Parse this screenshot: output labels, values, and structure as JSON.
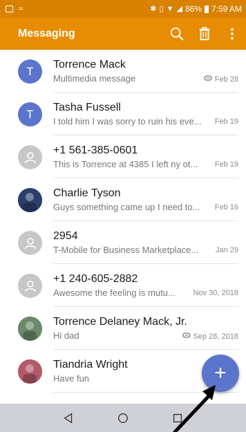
{
  "status_bar": {
    "battery": "86%",
    "time": "7:59 AM"
  },
  "app_bar": {
    "title": "Messaging",
    "actions": [
      "search-icon",
      "delete-icon",
      "more-vert-icon"
    ]
  },
  "conversations": [
    {
      "name": "Torrence Mack",
      "preview": "Multimedia message",
      "date": "Feb 28",
      "avatar": "T",
      "avatar_color": "#5b74cc",
      "attachment": true
    },
    {
      "name": "Tasha Fussell",
      "preview": "I told him I was sorry to ruin his eve...",
      "date": "Feb 19",
      "avatar": "T",
      "avatar_color": "#5b74cc",
      "attachment": false
    },
    {
      "name": "+1 561-385-0601",
      "preview": "This is Torrence at 4385 I left ny ot...",
      "date": "Feb 19",
      "avatar": "person-icon",
      "avatar_color": "#c7c7c7",
      "attachment": false
    },
    {
      "name": "Charlie Tyson",
      "preview": "Guys something came up I need to...",
      "date": "Feb 16",
      "avatar": "photo",
      "avatar_color": "#2a3f6b",
      "attachment": false
    },
    {
      "name": "2954",
      "preview": "T-Mobile for Business Marketplace...",
      "date": "Jan 29",
      "avatar": "person-icon",
      "avatar_color": "#c7c7c7",
      "attachment": false
    },
    {
      "name": "+1 240-605-2882",
      "preview": "Awesome the feeling is mutu...",
      "date": "Nov 30, 2018",
      "avatar": "person-icon",
      "avatar_color": "#c7c7c7",
      "attachment": false
    },
    {
      "name": "Torrence Delaney Mack, Jr.",
      "preview": "Hi dad",
      "date": "Sep 28, 2018",
      "avatar": "photo",
      "avatar_color": "#6b8a6a",
      "attachment": true
    },
    {
      "name": "Tiandria Wright",
      "preview": "Have fun",
      "date": "Se",
      "avatar": "photo",
      "avatar_color": "#b35a6a",
      "attachment": false
    }
  ],
  "fab": {
    "icon": "plus-icon"
  },
  "nav": [
    "back-icon",
    "home-icon",
    "recents-icon"
  ],
  "colors": {
    "status_bar": "#d98202",
    "app_bar": "#e88d03",
    "accent": "#5b74cc",
    "nav_bar": "#cfd1d6"
  }
}
